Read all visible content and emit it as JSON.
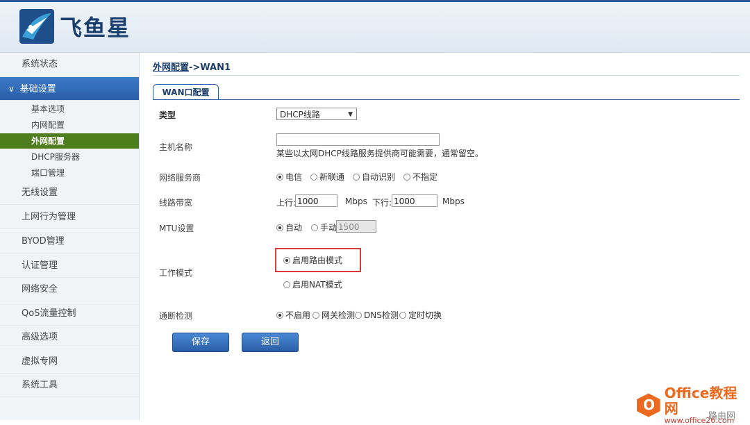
{
  "brand": {
    "name": "飞鱼星"
  },
  "sidebar": {
    "items": [
      {
        "label": "系统状态"
      },
      {
        "label": "基础设置"
      },
      {
        "label": "无线设置"
      },
      {
        "label": "上网行为管理"
      },
      {
        "label": "BYOD管理"
      },
      {
        "label": "认证管理"
      },
      {
        "label": "网络安全"
      },
      {
        "label": "QoS流量控制"
      },
      {
        "label": "高级选项"
      },
      {
        "label": "虚拟专网"
      },
      {
        "label": "系统工具"
      }
    ],
    "subitems": [
      {
        "label": "基本选项"
      },
      {
        "label": "内网配置"
      },
      {
        "label": "外网配置"
      },
      {
        "label": "DHCP服务器"
      },
      {
        "label": "端口管理"
      }
    ]
  },
  "breadcrumb": {
    "link": "外网配置",
    "rest": "->WAN1"
  },
  "tab": {
    "label": "WAN口配置"
  },
  "form": {
    "type": {
      "label": "类型",
      "value": "DHCP线路"
    },
    "hostname": {
      "label": "主机名称",
      "value": "",
      "hint": "某些以太网DHCP线路服务提供商可能需要，通常留空。"
    },
    "isp": {
      "label": "网络服务商",
      "options": [
        "电信",
        "新联通",
        "自动识别",
        "不指定"
      ],
      "selected": 0
    },
    "bandwidth": {
      "label": "线路带宽",
      "up_label": "上行:",
      "up_value": "1000",
      "down_label": "下行:",
      "down_value": "1000",
      "unit": "Mbps"
    },
    "mtu": {
      "label": "MTU设置",
      "options": [
        "自动",
        "手动"
      ],
      "selected": 0,
      "value": "1500"
    },
    "mode": {
      "label": "工作模式",
      "options": [
        "启用路由模式",
        "启用NAT模式"
      ],
      "selected": 0
    },
    "detect": {
      "label": "通断检测",
      "options": [
        "不启用",
        "网关检测",
        "DNS检测",
        "定时切换"
      ],
      "selected": 0
    }
  },
  "buttons": {
    "save": "保存",
    "back": "返回"
  },
  "watermark": {
    "title": "Office教程网",
    "url": "www.office26.com",
    "corner": "路由网"
  },
  "colors": {
    "accent": "#2a5ea8",
    "active_sub": "#4e7d1d",
    "highlight": "#d83a3a"
  }
}
